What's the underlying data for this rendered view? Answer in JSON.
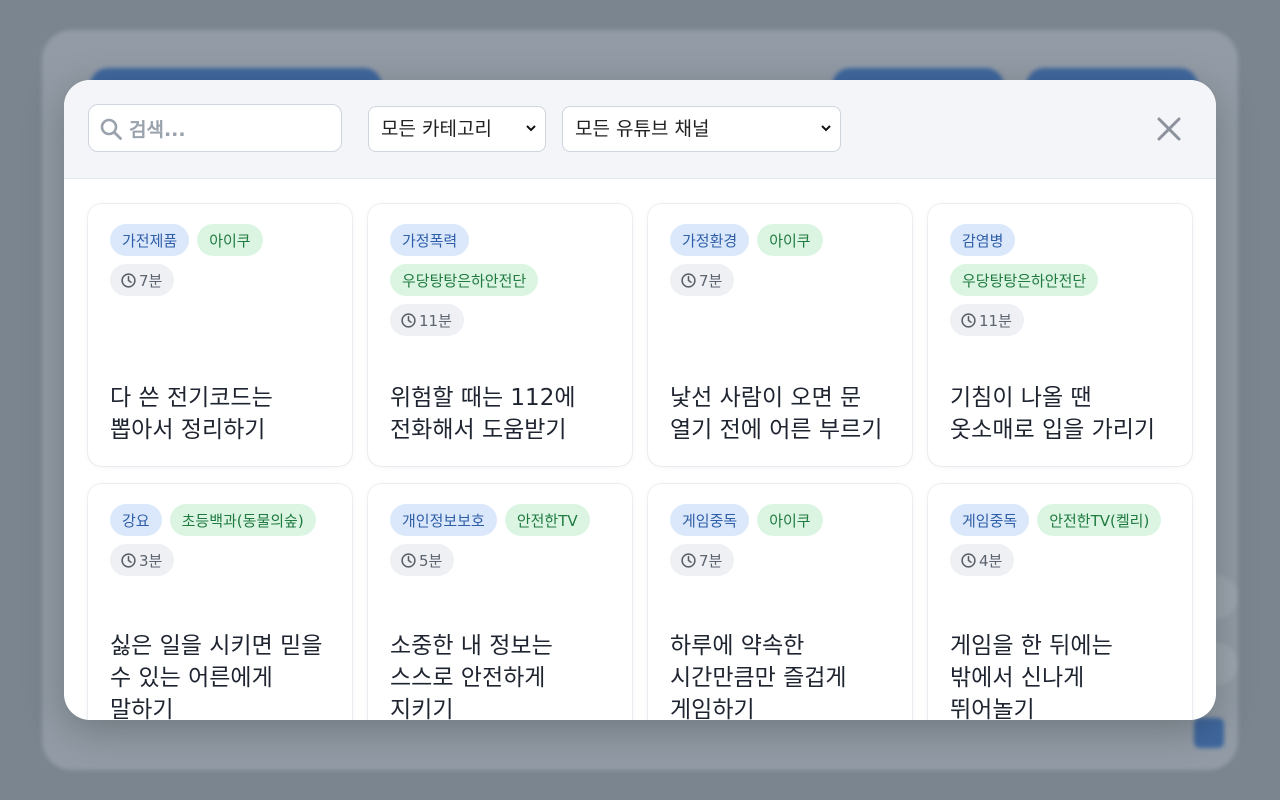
{
  "search": {
    "placeholder": "검색..."
  },
  "filters": {
    "category": "모든 카테고리",
    "channel": "모든 유튜브 채널"
  },
  "colors": {
    "category_tag_bg": "#dbe8fb",
    "channel_tag_bg": "#dcf5e3",
    "duration_tag_bg": "#eef0f3",
    "accent": "#3f6fb3"
  },
  "icons": {
    "search": "search-icon",
    "close": "close-icon",
    "duration": "clock-icon",
    "dropdown": "chevron-down-icon"
  },
  "cards": [
    {
      "category": "가전제품",
      "channel": "아이쿠",
      "duration": "7분",
      "title": "다 쓴 전기코드는 뽑아서 정리하기"
    },
    {
      "category": "가정폭력",
      "channel": "우당탕탕은하안전단",
      "duration": "11분",
      "title": "위험할 때는 112에 전화해서 도움받기"
    },
    {
      "category": "가정환경",
      "channel": "아이쿠",
      "duration": "7분",
      "title": "낯선 사람이 오면 문 열기 전에 어른 부르기"
    },
    {
      "category": "감염병",
      "channel": "우당탕탕은하안전단",
      "duration": "11분",
      "title": "기침이 나올 땐 옷소매로 입을 가리기"
    },
    {
      "category": "강요",
      "channel": "초등백과(동물의숲)",
      "duration": "3분",
      "title": "싫은 일을 시키면 믿을 수 있는 어른에게 말하기"
    },
    {
      "category": "개인정보보호",
      "channel": "안전한TV",
      "duration": "5분",
      "title": "소중한 내 정보는 스스로 안전하게 지키기"
    },
    {
      "category": "게임중독",
      "channel": "아이쿠",
      "duration": "7분",
      "title": "하루에 약속한 시간만큼만 즐겁게 게임하기"
    },
    {
      "category": "게임중독",
      "channel": "안전한TV(켈리)",
      "duration": "4분",
      "title": "게임을 한 뒤에는 밖에서 신나게 뛰어놀기"
    }
  ]
}
